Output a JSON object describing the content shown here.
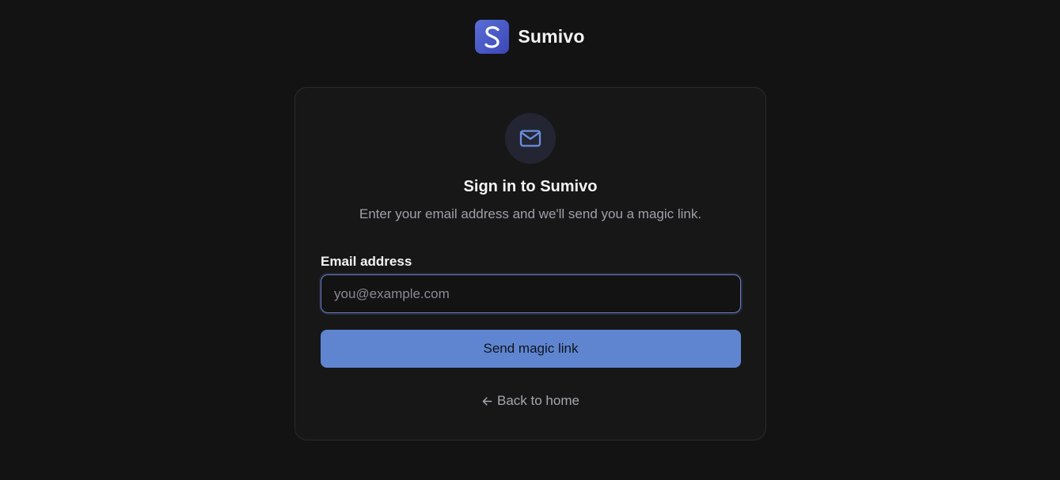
{
  "brand": {
    "name": "Sumivo",
    "logo_letter": "S",
    "logo_color": "#4f5fcf"
  },
  "card": {
    "title": "Sign in to Sumivo",
    "subtitle": "Enter your email address and we'll send you a magic link.",
    "icon": "mail-icon"
  },
  "form": {
    "email_label": "Email address",
    "email_placeholder": "you@example.com",
    "email_value": "",
    "submit_label": "Send magic link"
  },
  "footer": {
    "back_icon": "arrow-left-icon",
    "back_label": "Back to home"
  },
  "colors": {
    "background": "#131314",
    "card": "#171718",
    "accent": "#5f85d0",
    "input_focus_border": "#6b7fc4"
  }
}
